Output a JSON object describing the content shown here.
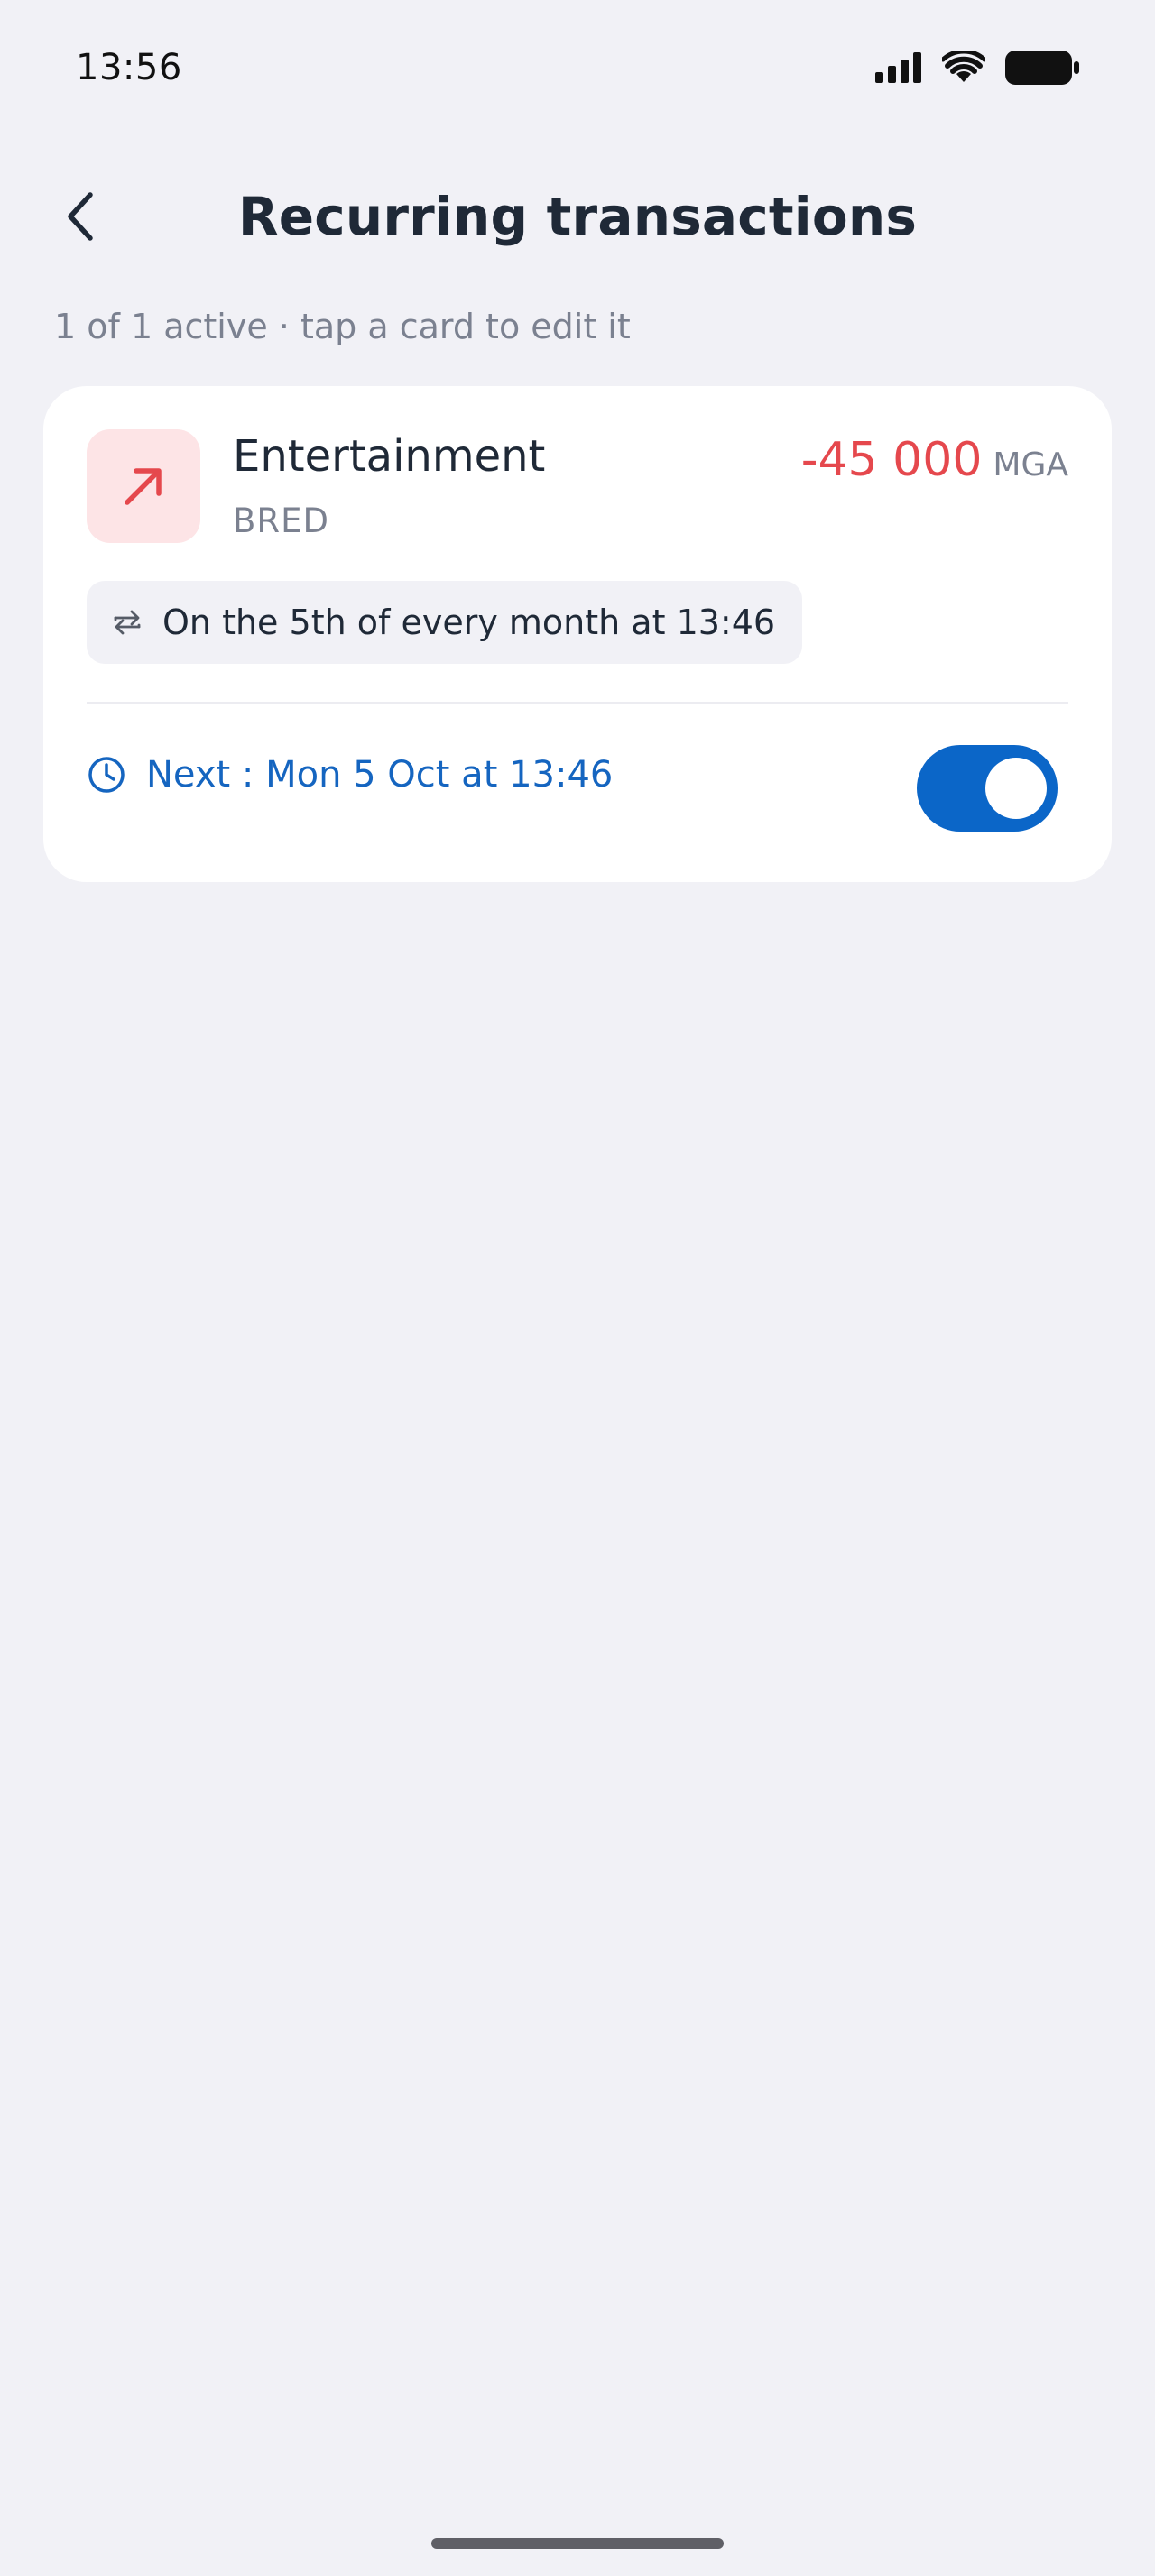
{
  "status_bar": {
    "time": "13:56",
    "icons": [
      "signal-icon",
      "wifi-icon",
      "battery-icon"
    ]
  },
  "header": {
    "title": "Recurring transactions",
    "back_icon": "chevron-left-icon"
  },
  "subtitle": "1 of 1 active · tap a card to edit it",
  "transactions": [
    {
      "category": "Entertainment",
      "account": "BRED",
      "amount": "-45 000",
      "currency": "MGA",
      "schedule": "On the 5th of every month at 13:46",
      "next": "Next : Mon 5 Oct at 13:46",
      "active": true,
      "icon": "arrow-up-right-icon"
    }
  ],
  "colors": {
    "background": "#f1f1f6",
    "expense": "#e5484d",
    "accent": "#0b66c8",
    "link": "#1565c0"
  }
}
